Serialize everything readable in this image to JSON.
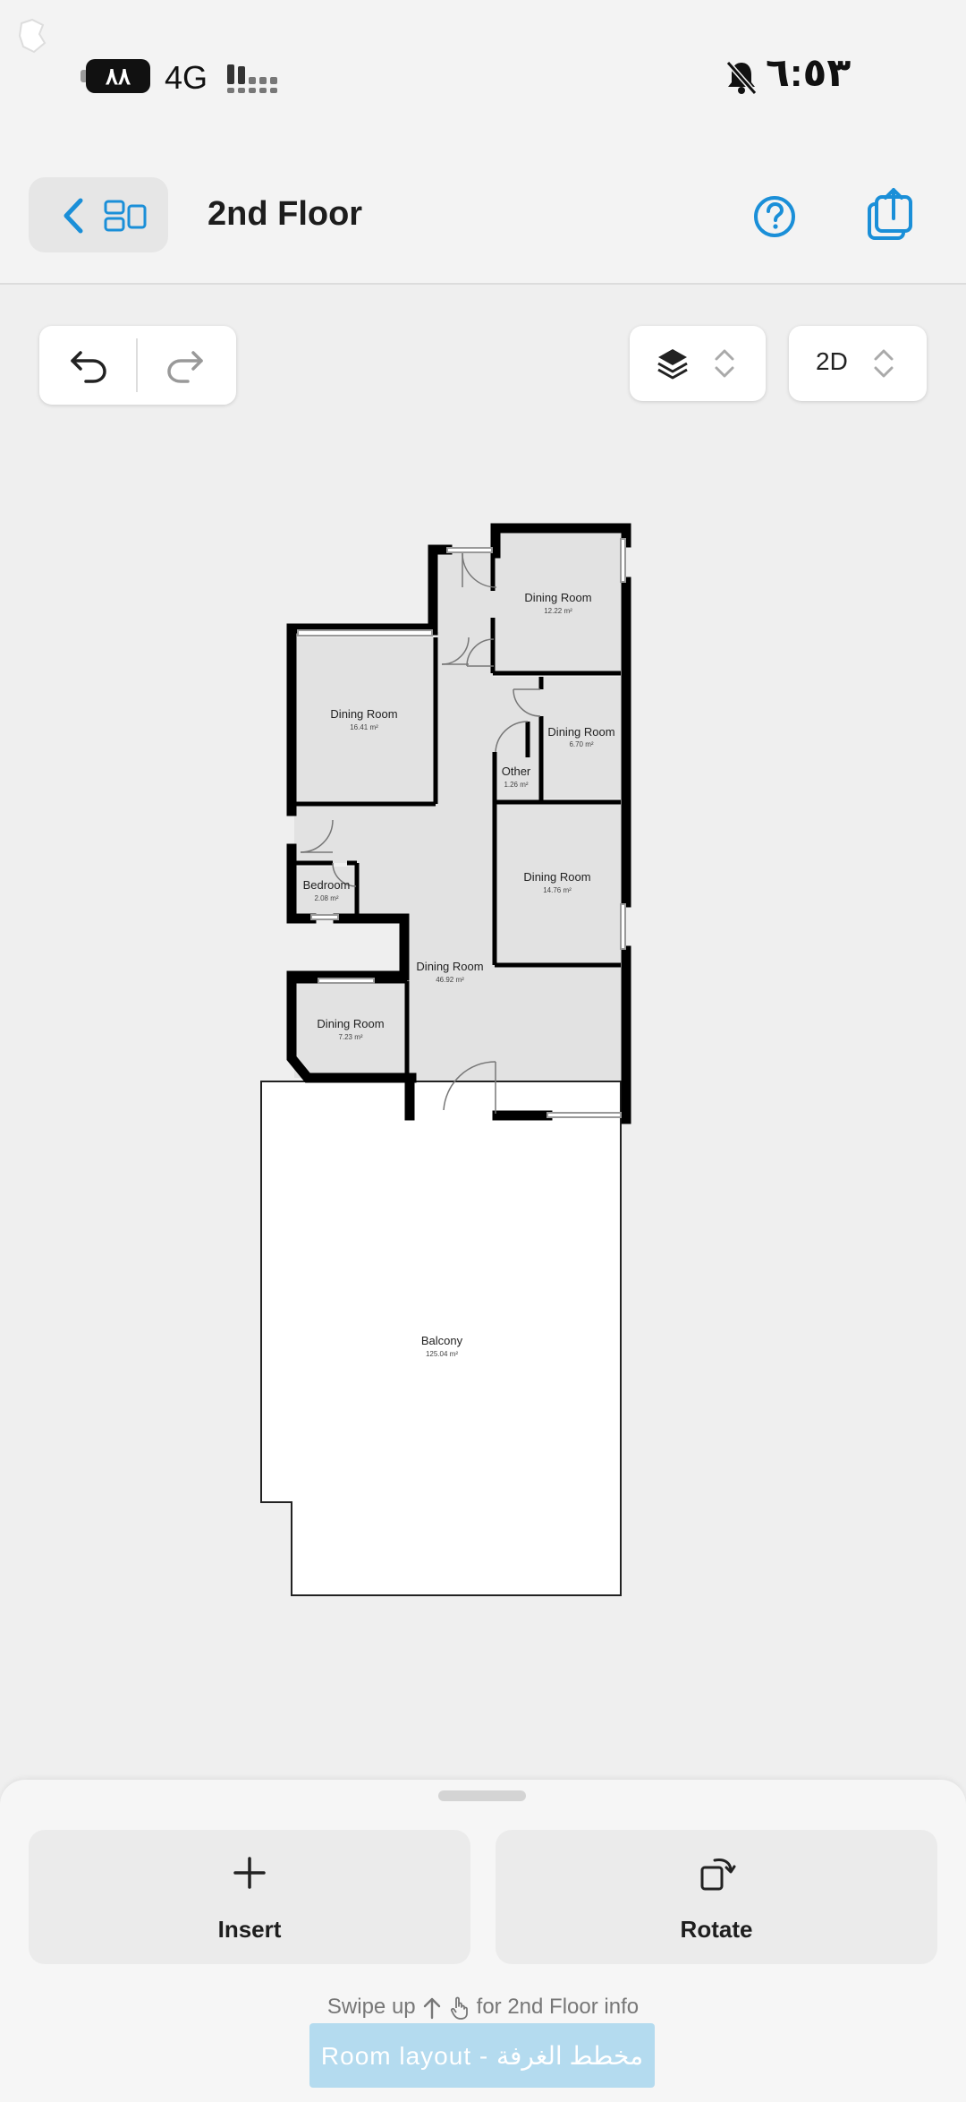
{
  "status_bar": {
    "battery": "٨٨",
    "network": "4G",
    "time": "٦:٥٣"
  },
  "header": {
    "title": "2nd Floor"
  },
  "toolbar": {
    "view_mode": "2D"
  },
  "floor_plan": {
    "rooms": [
      {
        "name": "Dining Room",
        "area": "12.22 m²"
      },
      {
        "name": "Dining Room",
        "area": "16.41 m²"
      },
      {
        "name": "Dining Room",
        "area": "6.70 m²"
      },
      {
        "name": "Other",
        "area": "1.26 m²"
      },
      {
        "name": "Bedroom",
        "area": "2.08 m²"
      },
      {
        "name": "Dining Room",
        "area": "14.76 m²"
      },
      {
        "name": "Dining Room",
        "area": "46.92 m²"
      },
      {
        "name": "Dining Room",
        "area": "7.23 m²"
      },
      {
        "name": "Balcony",
        "area": "125.04 m²"
      }
    ]
  },
  "bottom_sheet": {
    "insert_label": "Insert",
    "rotate_label": "Rotate",
    "hint_prefix": "Swipe up",
    "hint_suffix": "for 2nd Floor info"
  },
  "caption": "Room layout - مخطط الغرفة",
  "icons": {
    "accent_color": "#1a8fd8"
  }
}
